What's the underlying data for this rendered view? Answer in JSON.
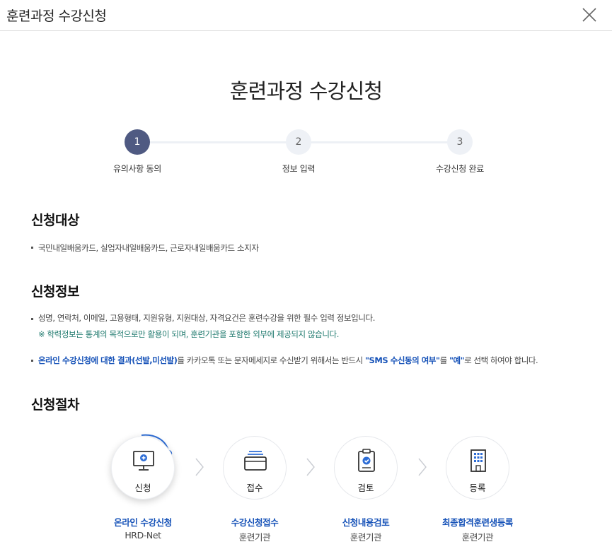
{
  "window": {
    "title": "훈련과정 수강신청"
  },
  "main_title": "훈련과정 수강신청",
  "stepper": [
    {
      "number": "1",
      "label": "유의사항 동의"
    },
    {
      "number": "2",
      "label": "정보 입력"
    },
    {
      "number": "3",
      "label": "수강신청 완료"
    }
  ],
  "target": {
    "heading": "신청대상",
    "text": "국민내일배움카드, 실업자내일배움카드, 근로자내일배움카드 소지자"
  },
  "info": {
    "heading": "신청정보",
    "text": "성명, 연락처, 이메일, 고용형태, 지원유형, 지원대상, 자격요건은 훈련수강을 위한 필수 입력 정보입니다.",
    "note": "※ 학력정보는 통계의 목적으로만 활용이 되며, 훈련기관을 포함한 외부에 제공되지 않습니다.",
    "sms": {
      "part1": "온라인 수강신청에 대한 결과(선발,미선발)",
      "part2": "를 카카오톡 또는 문자메세지로 수신받기 위해서는 반드시 ",
      "part3": "\"SMS 수신동의 여부\"",
      "part4": "를 ",
      "part5": "\"예\"",
      "part6": "로 선택 하여야 합니다."
    }
  },
  "procedure": {
    "heading": "신청절차",
    "steps": [
      {
        "icon": "monitor-icon",
        "label": "신청",
        "name": "온라인 수강신청",
        "sub": "HRD-Net"
      },
      {
        "icon": "inbox-icon",
        "label": "접수",
        "name": "수강신청접수",
        "sub": "훈련기관"
      },
      {
        "icon": "clipboard-check-icon",
        "label": "검토",
        "name": "신청내용검토",
        "sub": "훈련기관"
      },
      {
        "icon": "building-icon",
        "label": "등록",
        "name": "최종합격훈련생등록",
        "sub": "훈련기관"
      }
    ]
  },
  "colors": {
    "accent": "#4f5a82",
    "link_blue": "#1652b8",
    "note_green": "#1f7a6e",
    "icon_blue": "#2f6ed6"
  }
}
